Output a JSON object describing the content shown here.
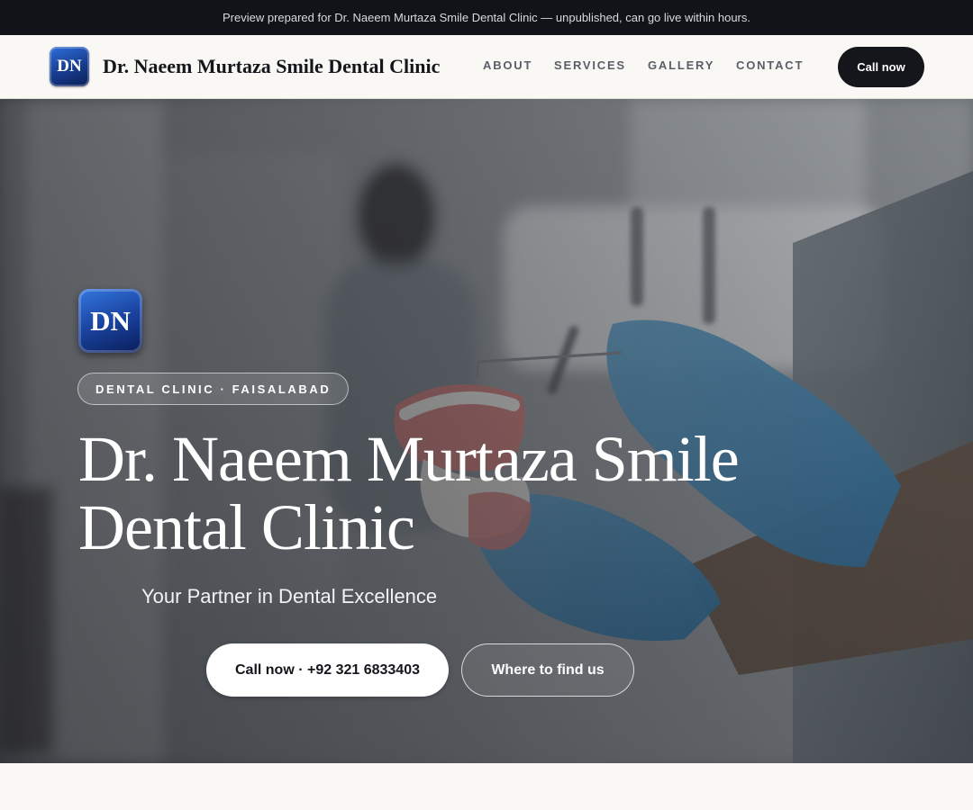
{
  "banner": {
    "text": "Preview prepared for Dr. Naeem Murtaza Smile Dental Clinic — unpublished, can go live within hours."
  },
  "header": {
    "logo_initials": "DN",
    "brand_name": "Dr. Naeem Murtaza Smile Dental Clinic",
    "nav": {
      "about": "ABOUT",
      "services": "SERVICES",
      "gallery": "GALLERY",
      "contact": "CONTACT"
    },
    "call_label": "Call now"
  },
  "hero": {
    "logo_initials": "DN",
    "tag": "DENTAL CLINIC · FAISALABAD",
    "title_line1": "Dr. Naeem Murtaza Smile",
    "title_line2": "Dental Clinic",
    "subtitle": "Your Partner in Dental Excellence",
    "call_button": "Call now · +92 321 6833403",
    "find_button": "Where to find us",
    "background_image": "dentist-holding-denture-model-photo"
  },
  "colors": {
    "banner_bg": "#111318",
    "header_bg": "#f9f8f5",
    "primary_dark": "#14161b",
    "logo_blue": "#1a43a0",
    "glove_blue": "#4f8fb8"
  },
  "icons": {
    "logo": "dn-monogram-icon"
  }
}
